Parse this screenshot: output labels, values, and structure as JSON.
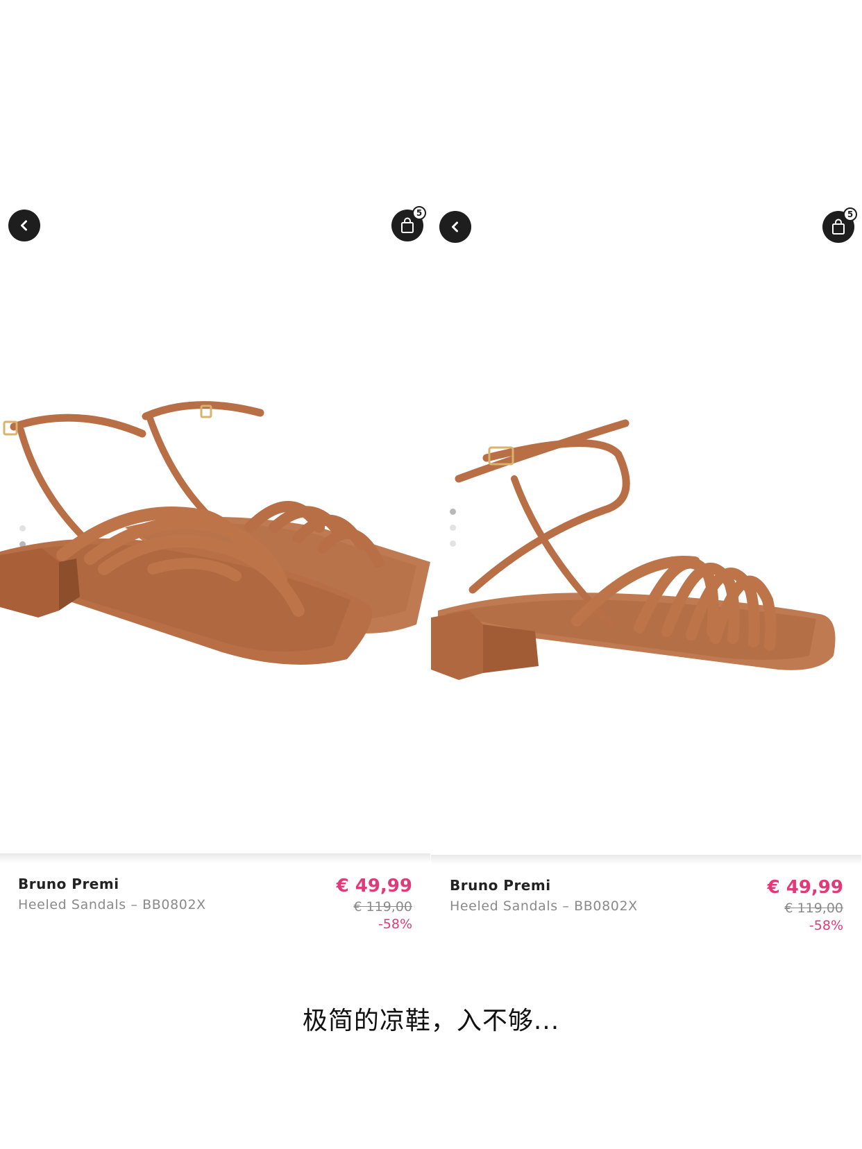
{
  "products": [
    {
      "brand": "Bruno Premi",
      "subtitle": "Heeled Sandals – BB0802X",
      "price": "€ 49,99",
      "old_price": "€ 119,00",
      "discount": "-58%",
      "cart_count": "5"
    },
    {
      "brand": "Bruno Premi",
      "subtitle": "Heeled Sandals – BB0802X",
      "price": "€ 49,99",
      "old_price": "€ 119,00",
      "discount": "-58%",
      "cart_count": "5"
    }
  ],
  "icons": {
    "back": "chevron-left-icon",
    "cart": "shopping-bag-icon"
  },
  "colors": {
    "price": "#e13a7b",
    "sandal": "#b57048",
    "button": "#1e1e1e"
  },
  "caption": "极简的凉鞋，入不够..."
}
